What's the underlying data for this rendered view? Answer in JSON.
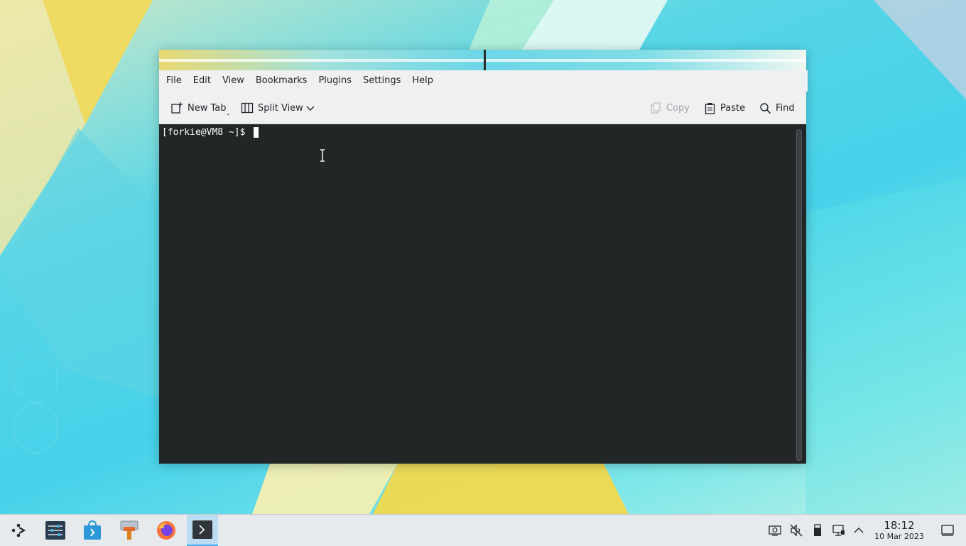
{
  "window": {
    "menu": [
      "File",
      "Edit",
      "View",
      "Bookmarks",
      "Plugins",
      "Settings",
      "Help"
    ],
    "toolbar": {
      "new_tab": "New Tab",
      "split_view": "Split View",
      "copy": "Copy",
      "paste": "Paste",
      "find": "Find"
    },
    "terminal": {
      "prompt": "[forkie@VM8 ~]$ "
    }
  },
  "taskbar": {
    "apps": [
      {
        "icon": "application-launcher-icon"
      },
      {
        "icon": "system-settings-icon"
      },
      {
        "icon": "discover-store-icon"
      },
      {
        "icon": "hammer-dev-tool-icon"
      },
      {
        "icon": "firefox-icon"
      },
      {
        "icon": "konsole-icon",
        "active": true
      }
    ],
    "tray": [
      "screen-capture-icon",
      "volume-muted-icon",
      "usb-device-icon",
      "network-wired-icon",
      "tray-expand-icon"
    ],
    "clock": {
      "time": "18:12",
      "date": "10 Mar 2023"
    }
  },
  "colors": {
    "accent": "#3daee9",
    "terminal_bg": "#232627",
    "terminal_fg": "#fcfcfc",
    "chrome_bg": "#eff0f1"
  }
}
